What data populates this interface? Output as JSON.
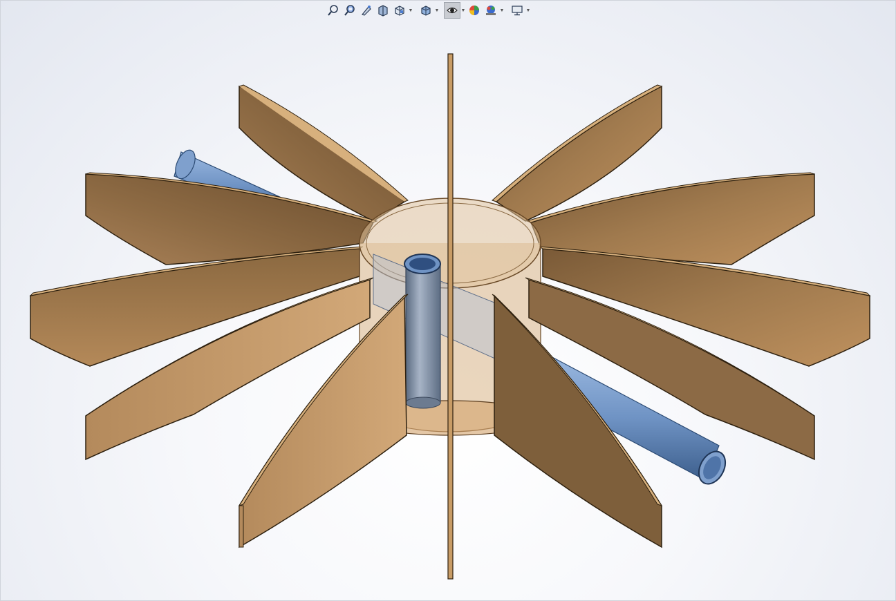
{
  "viewport": {
    "background_top": "#e3e7f0",
    "background_center": "#ffffff"
  },
  "toolbar": {
    "buttons": [
      {
        "icon": "zoom-to-fit-icon",
        "has_dropdown": false
      },
      {
        "icon": "zoom-to-area-icon",
        "has_dropdown": false
      },
      {
        "icon": "previous-view-icon",
        "has_dropdown": false
      },
      {
        "icon": "section-view-icon",
        "has_dropdown": false
      },
      {
        "icon": "view-orientation-icon",
        "has_dropdown": true
      },
      {
        "icon": "display-style-icon",
        "has_dropdown": true
      },
      {
        "icon": "hide-show-items-icon",
        "has_dropdown": true,
        "active": true
      },
      {
        "icon": "edit-appearance-icon",
        "has_dropdown": false
      },
      {
        "icon": "apply-scene-icon",
        "has_dropdown": true
      },
      {
        "icon": "view-settings-icon",
        "has_dropdown": true
      }
    ]
  },
  "model": {
    "blade_count": 12,
    "colors": {
      "wood_light": "#c59a6a",
      "wood_dark": "#6b4f30",
      "wood_edge": "#3a2a18",
      "pipe_blue": "#6f93c4",
      "pipe_dark": "#3d5f8d",
      "hub_transparent": "#d8b58c"
    }
  }
}
